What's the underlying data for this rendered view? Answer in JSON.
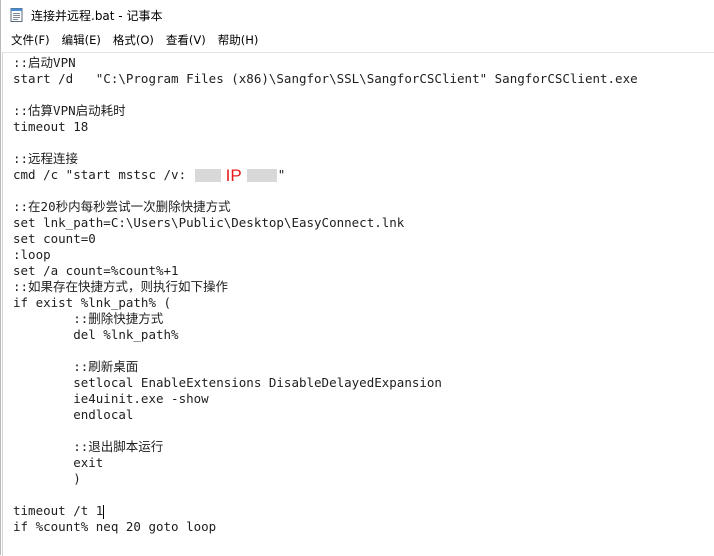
{
  "window": {
    "title": "连接并远程.bat - 记事本",
    "icon": "notepad-icon"
  },
  "menu": [
    {
      "label": "文件(F)"
    },
    {
      "label": "编辑(E)"
    },
    {
      "label": "格式(O)"
    },
    {
      "label": "查看(V)"
    },
    {
      "label": "帮助(H)"
    }
  ],
  "editor": {
    "lines": [
      "::启动VPN",
      "start /d   \"C:\\Program Files (x86)\\Sangfor\\SSL\\SangforCSClient\" SangforCSClient.exe",
      "",
      "::估算VPN启动耗时",
      "timeout 18",
      "",
      "::远程连接",
      "",
      "",
      "::在20秒内每秒尝试一次删除快捷方式",
      "set lnk_path=C:\\Users\\Public\\Desktop\\EasyConnect.lnk",
      "set count=0",
      ":loop",
      "set /a count=%count%+1",
      "::如果存在快捷方式，则执行如下操作",
      "if exist %lnk_path% (",
      "        ::删除快捷方式",
      "        del %lnk_path%",
      "",
      "        ::刷新桌面",
      "        setlocal EnableExtensions DisableDelayedExpansion",
      "        ie4uinit.exe -show",
      "        endlocal",
      "",
      "        ::退出脚本运行",
      "        exit",
      "        )",
      "",
      "timeout /t 1",
      "if %count% neq 20 goto loop"
    ],
    "mstsc_line": {
      "prefix": "cmd /c \"start mstsc /v: ",
      "ip_label": "IP",
      "suffix": "\""
    }
  }
}
